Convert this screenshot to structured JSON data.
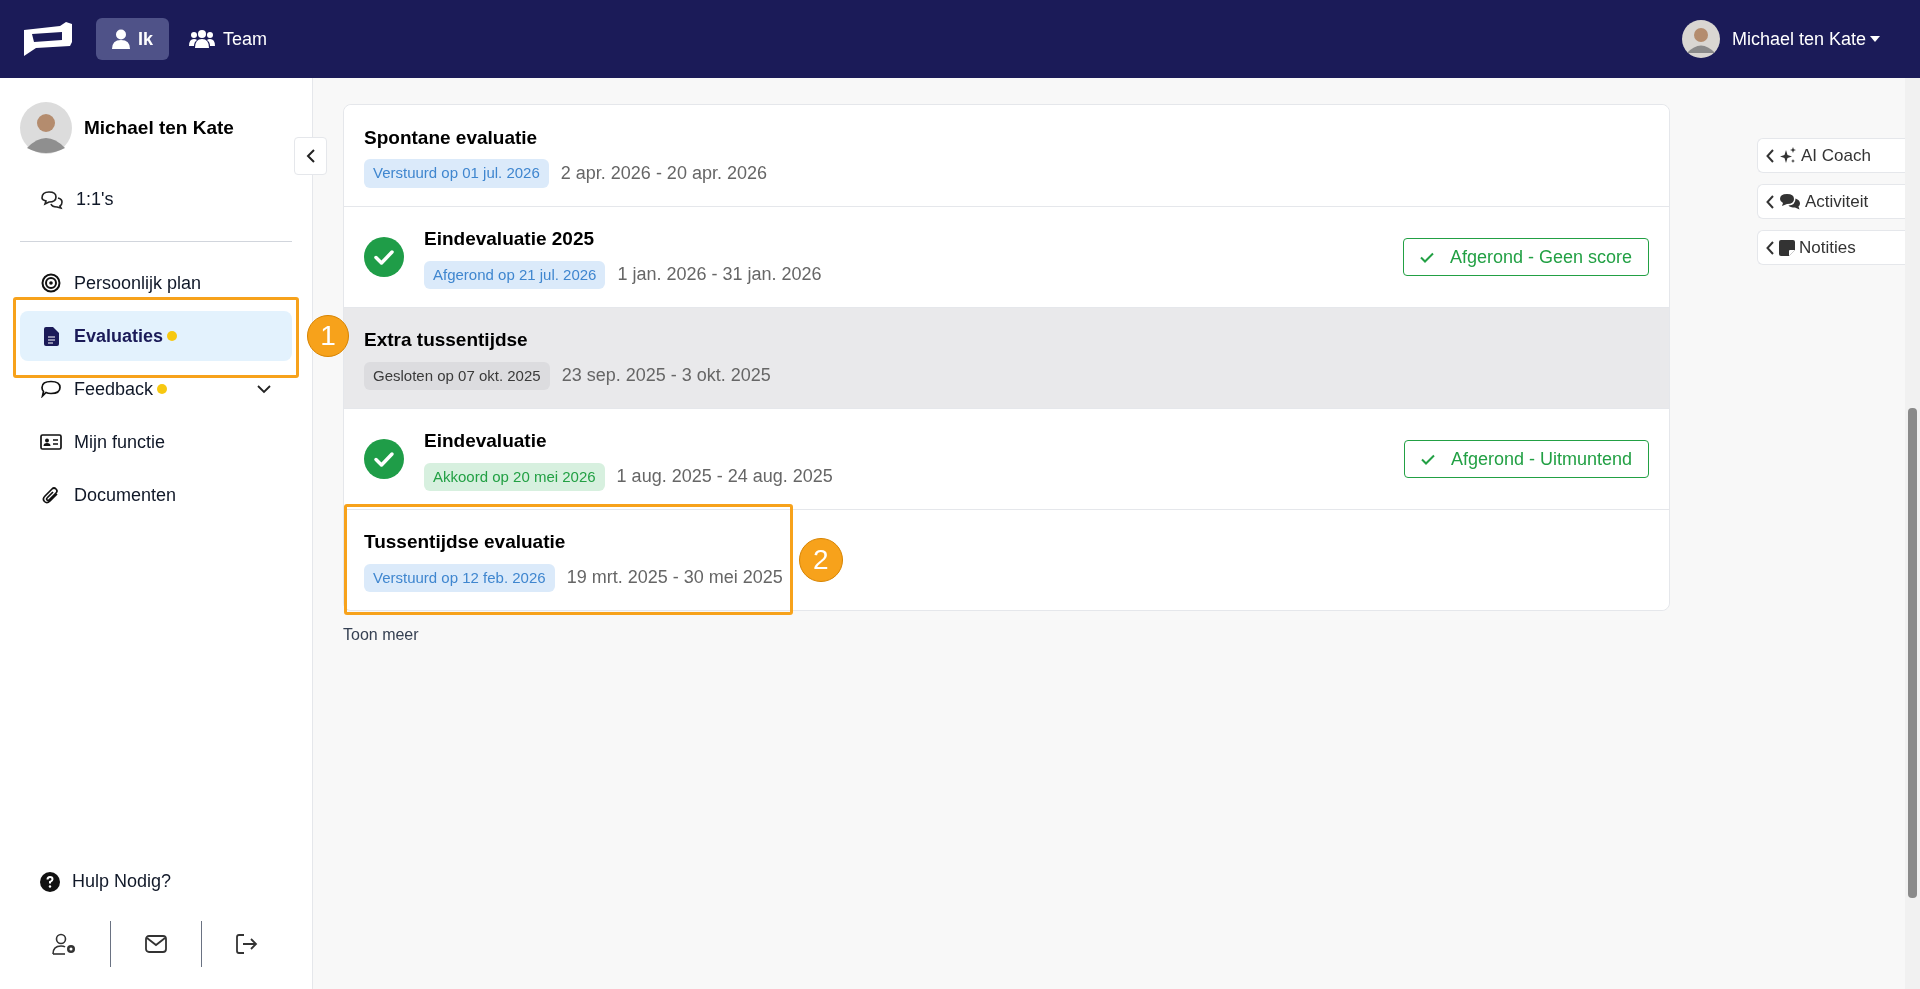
{
  "top_bar": {
    "tabs": [
      {
        "label": "Ik",
        "selected": true
      },
      {
        "label": "Team",
        "selected": false
      }
    ],
    "user_name": "Michael ten Kate"
  },
  "sidebar": {
    "profile_name": "Michael ten Kate",
    "top_items": [
      {
        "label": "1:1's"
      }
    ],
    "items": [
      {
        "label": "Persoonlijk plan",
        "selected": false,
        "dot": false,
        "expandable": false
      },
      {
        "label": "Evaluaties",
        "selected": true,
        "dot": true,
        "expandable": false,
        "marker": "1"
      },
      {
        "label": "Feedback",
        "selected": false,
        "dot": true,
        "expandable": true
      },
      {
        "label": "Mijn functie",
        "selected": false,
        "dot": false,
        "expandable": false
      },
      {
        "label": "Documenten",
        "selected": false,
        "dot": false,
        "expandable": false
      }
    ],
    "help": "Hulp Nodig?"
  },
  "evaluations": [
    {
      "title": "Spontane evaluatie",
      "done": false,
      "badge": "Verstuurd op 01 jul. 2026",
      "kind": "info",
      "period": "2 apr. 2026 - 20 apr. 2026",
      "highlighted": false
    },
    {
      "title": "Eindevaluatie 2025",
      "done": true,
      "badge": "Afgerond op 21 jul. 2026",
      "kind": "info",
      "period": "1 jan. 2026 - 31 jan. 2026",
      "result": "Afgerond - Geen score",
      "highlighted": false
    },
    {
      "title": "Extra tussentijdse",
      "done": false,
      "badge": "Gesloten op 07 okt. 2025",
      "kind": "muted",
      "period": "23 sep. 2025 - 3 okt. 2025",
      "highlighted": true
    },
    {
      "title": "Eindevaluatie",
      "done": true,
      "badge": "Akkoord op 20 mei 2026",
      "kind": "success",
      "period": "1 aug. 2025 - 24 aug. 2025",
      "result": "Afgerond - Uitmuntend",
      "highlighted": false
    },
    {
      "title": "Tussentijdse evaluatie",
      "done": false,
      "badge": "Verstuurd op 12 feb. 2026",
      "kind": "info",
      "period": "19 mrt. 2025 - 30 mei 2025",
      "highlighted": false,
      "marker": "2"
    }
  ],
  "show_more": "Toon meer",
  "side_panels": [
    {
      "label": "AI Coach"
    },
    {
      "label": "Activiteit"
    },
    {
      "label": "Notities"
    }
  ]
}
